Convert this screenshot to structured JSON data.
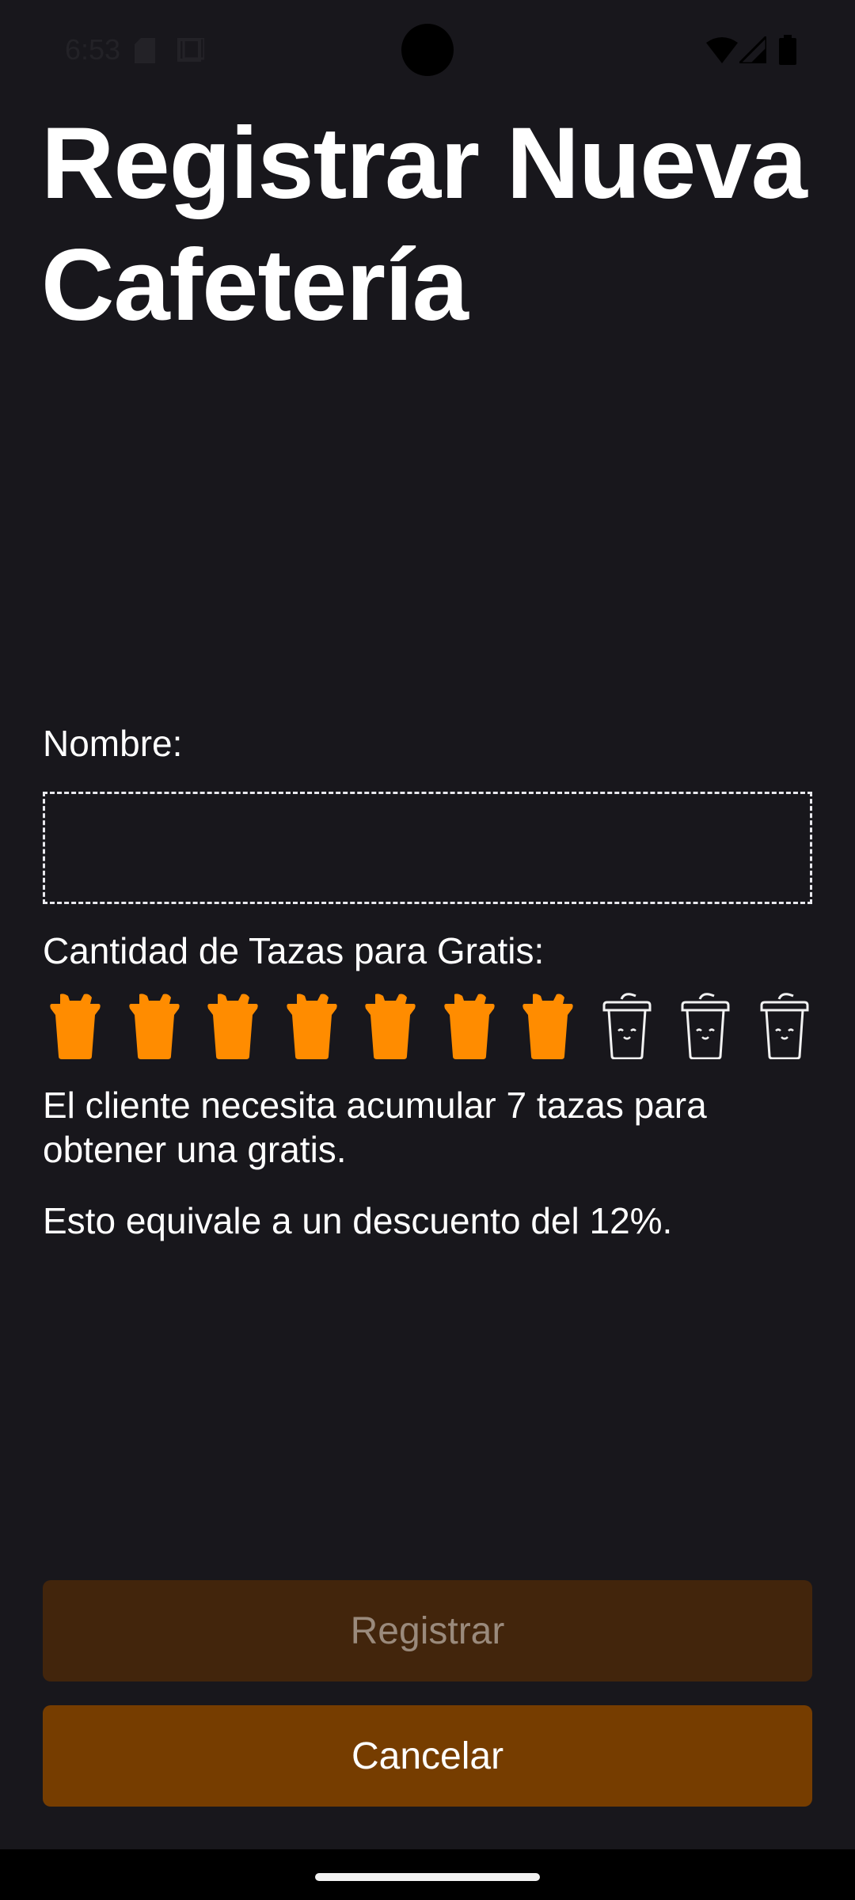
{
  "status_bar": {
    "time": "6:53"
  },
  "page": {
    "title": "Registrar Nueva Cafetería"
  },
  "form": {
    "name_label": "Nombre:",
    "name_value": "",
    "cups_label": "Cantidad de Tazas para Gratis:",
    "cups_selected": 7,
    "cups_total": 10,
    "info_cups": "El cliente necesita acumular 7 tazas para obtener una gratis.",
    "info_discount": "Esto equivale a un descuento del 12%."
  },
  "buttons": {
    "register": "Registrar",
    "cancel": "Cancelar"
  },
  "colors": {
    "accent": "#ff8c00",
    "register_bg": "#42250c",
    "cancel_bg": "#763d00",
    "background": "#18171c"
  },
  "icons": {
    "cup_filled": "cup-filled-icon",
    "cup_empty": "cup-outline-icon"
  }
}
